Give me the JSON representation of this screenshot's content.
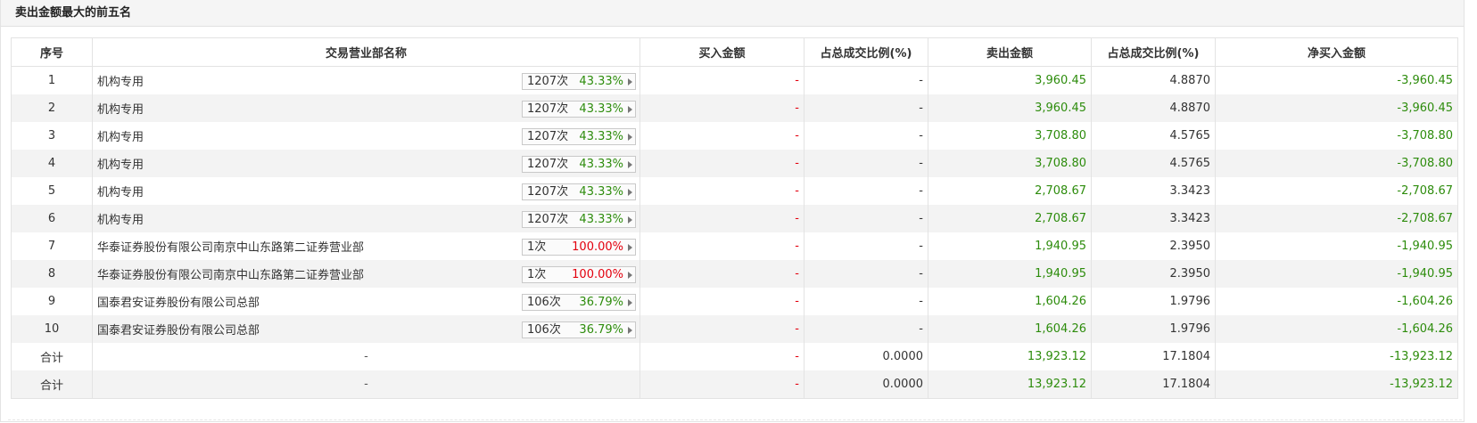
{
  "panel": {
    "title": "卖出金额最大的前五名"
  },
  "table": {
    "headers": {
      "idx": "序号",
      "name": "交易营业部名称",
      "buy": "买入金额",
      "buy_ratio": "占总成交比例(%)",
      "sell": "卖出金额",
      "sell_ratio": "占总成交比例(%)",
      "net": "净买入金额"
    },
    "rows": [
      {
        "idx": "1",
        "name": "机构专用",
        "count": "1207次",
        "pct": "43.33%",
        "pct_color": "green",
        "buy": "-",
        "buy_ratio": "-",
        "sell": "3,960.45",
        "sell_ratio": "4.8870",
        "net": "-3,960.45"
      },
      {
        "idx": "2",
        "name": "机构专用",
        "count": "1207次",
        "pct": "43.33%",
        "pct_color": "green",
        "buy": "-",
        "buy_ratio": "-",
        "sell": "3,960.45",
        "sell_ratio": "4.8870",
        "net": "-3,960.45"
      },
      {
        "idx": "3",
        "name": "机构专用",
        "count": "1207次",
        "pct": "43.33%",
        "pct_color": "green",
        "buy": "-",
        "buy_ratio": "-",
        "sell": "3,708.80",
        "sell_ratio": "4.5765",
        "net": "-3,708.80"
      },
      {
        "idx": "4",
        "name": "机构专用",
        "count": "1207次",
        "pct": "43.33%",
        "pct_color": "green",
        "buy": "-",
        "buy_ratio": "-",
        "sell": "3,708.80",
        "sell_ratio": "4.5765",
        "net": "-3,708.80"
      },
      {
        "idx": "5",
        "name": "机构专用",
        "count": "1207次",
        "pct": "43.33%",
        "pct_color": "green",
        "buy": "-",
        "buy_ratio": "-",
        "sell": "2,708.67",
        "sell_ratio": "3.3423",
        "net": "-2,708.67"
      },
      {
        "idx": "6",
        "name": "机构专用",
        "count": "1207次",
        "pct": "43.33%",
        "pct_color": "green",
        "buy": "-",
        "buy_ratio": "-",
        "sell": "2,708.67",
        "sell_ratio": "3.3423",
        "net": "-2,708.67"
      },
      {
        "idx": "7",
        "name": "华泰证券股份有限公司南京中山东路第二证券营业部",
        "count": "1次",
        "pct": "100.00%",
        "pct_color": "red",
        "buy": "-",
        "buy_ratio": "-",
        "sell": "1,940.95",
        "sell_ratio": "2.3950",
        "net": "-1,940.95"
      },
      {
        "idx": "8",
        "name": "华泰证券股份有限公司南京中山东路第二证券营业部",
        "count": "1次",
        "pct": "100.00%",
        "pct_color": "red",
        "buy": "-",
        "buy_ratio": "-",
        "sell": "1,940.95",
        "sell_ratio": "2.3950",
        "net": "-1,940.95"
      },
      {
        "idx": "9",
        "name": "国泰君安证券股份有限公司总部",
        "count": "106次",
        "pct": "36.79%",
        "pct_color": "green",
        "buy": "-",
        "buy_ratio": "-",
        "sell": "1,604.26",
        "sell_ratio": "1.9796",
        "net": "-1,604.26"
      },
      {
        "idx": "10",
        "name": "国泰君安证券股份有限公司总部",
        "count": "106次",
        "pct": "36.79%",
        "pct_color": "green",
        "buy": "-",
        "buy_ratio": "-",
        "sell": "1,604.26",
        "sell_ratio": "1.9796",
        "net": "-1,604.26"
      }
    ],
    "totals": [
      {
        "label": "合计",
        "name": "-",
        "buy": "-",
        "buy_ratio": "0.0000",
        "sell": "13,923.12",
        "sell_ratio": "17.1804",
        "net": "-13,923.12"
      },
      {
        "label": "合计",
        "name": "-",
        "buy": "-",
        "buy_ratio": "0.0000",
        "sell": "13,923.12",
        "sell_ratio": "17.1804",
        "net": "-13,923.12"
      }
    ]
  },
  "colors": {
    "negative": "#2d8c0c",
    "positive": "#e3000e",
    "row_alt_bg": "#f3f3f3",
    "border": "#e3e3e3"
  }
}
